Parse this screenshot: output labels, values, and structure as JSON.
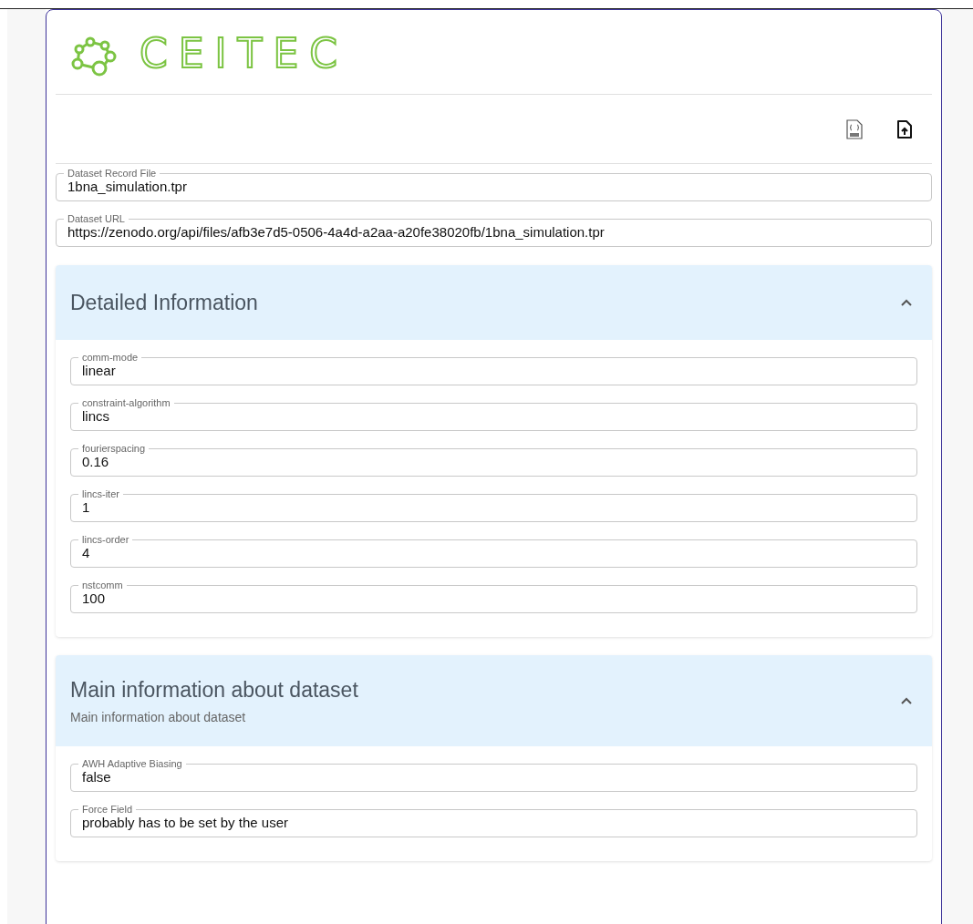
{
  "logo": {
    "text": "CEITEC"
  },
  "record_fields": [
    {
      "label": "Dataset Record File",
      "value": "1bna_simulation.tpr"
    },
    {
      "label": "Dataset URL",
      "value": "https://zenodo.org/api/files/afb3e7d5-0506-4a4d-a2aa-a20fe38020fb/1bna_simulation.tpr"
    }
  ],
  "sections": [
    {
      "title": "Detailed Information",
      "expanded": true,
      "fields": [
        {
          "label": "comm-mode",
          "value": "linear"
        },
        {
          "label": "constraint-algorithm",
          "value": "lincs"
        },
        {
          "label": "fourierspacing",
          "value": "0.16"
        },
        {
          "label": "lincs-iter",
          "value": "1"
        },
        {
          "label": "lincs-order",
          "value": "4"
        },
        {
          "label": "nstcomm",
          "value": "100"
        }
      ]
    },
    {
      "title": "Main information about dataset",
      "subtitle": "Main information about dataset",
      "expanded": true,
      "fields": [
        {
          "label": "AWH Adaptive Biasing",
          "value": "false"
        },
        {
          "label": "Force Field",
          "value": "probably has to be set by the user"
        }
      ]
    }
  ]
}
